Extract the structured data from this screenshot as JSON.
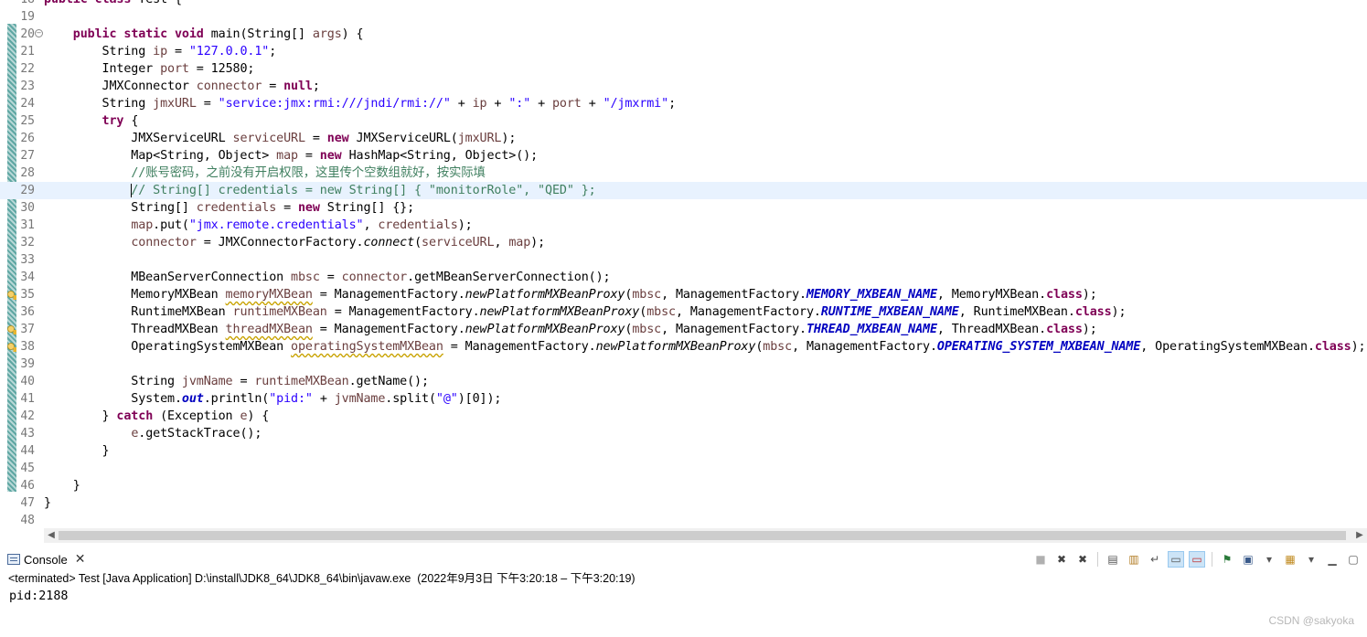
{
  "editor": {
    "lines": [
      {
        "n": "18",
        "html": "<span class=\"kw\">public class</span> Test {"
      },
      {
        "n": "19",
        "html": ""
      },
      {
        "n": "20",
        "fold": true,
        "html": "    <span class=\"kw\">public static void</span> main(String[] <span class=\"var\">args</span>) {"
      },
      {
        "n": "21",
        "html": "        String <span class=\"var\">ip</span> = <span class=\"str\">\"127.0.0.1\"</span>;"
      },
      {
        "n": "22",
        "html": "        Integer <span class=\"var\">port</span> = 12580;"
      },
      {
        "n": "23",
        "html": "        JMXConnector <span class=\"var\">connector</span> = <span class=\"kw\">null</span>;"
      },
      {
        "n": "24",
        "html": "        String <span class=\"var\">jmxURL</span> = <span class=\"str\">\"service:jmx:rmi:///jndi/rmi://\"</span> + <span class=\"var\">ip</span> + <span class=\"str\">\":\"</span> + <span class=\"var\">port</span> + <span class=\"str\">\"/jmxrmi\"</span>;"
      },
      {
        "n": "25",
        "html": "        <span class=\"kw\">try</span> {"
      },
      {
        "n": "26",
        "html": "            JMXServiceURL <span class=\"var\">serviceURL</span> = <span class=\"kw\">new</span> JMXServiceURL(<span class=\"var\">jmxURL</span>);"
      },
      {
        "n": "27",
        "html": "            Map&lt;String, Object&gt; <span class=\"var\">map</span> = <span class=\"kw\">new</span> HashMap&lt;String, Object&gt;();"
      },
      {
        "n": "28",
        "html": "            <span class=\"cmt\">//账号密码，之前没有开启权限，这里传个空数组就好，按实际填</span>"
      },
      {
        "n": "29",
        "current": true,
        "html": "            <span class=\"caret\"></span><span class=\"cmt\">// String[] credentials = new String[] { \"monitorRole\", \"QED\" };</span>"
      },
      {
        "n": "30",
        "html": "            String[] <span class=\"var\">credentials</span> = <span class=\"kw\">new</span> String[] {};"
      },
      {
        "n": "31",
        "html": "            <span class=\"var\">map</span>.put(<span class=\"str\">\"jmx.remote.credentials\"</span>, <span class=\"var\">credentials</span>);"
      },
      {
        "n": "32",
        "html": "            <span class=\"var\">connector</span> = JMXConnectorFactory.<span class=\"it\">connect</span>(<span class=\"var\">serviceURL</span>, <span class=\"var\">map</span>);"
      },
      {
        "n": "33",
        "html": ""
      },
      {
        "n": "34",
        "html": "            MBeanServerConnection <span class=\"var\">mbsc</span> = <span class=\"var\">connector</span>.getMBeanServerConnection();"
      },
      {
        "n": "35",
        "warn": true,
        "html": "            MemoryMXBean <span class=\"var warnsq\">memoryMXBean</span> = ManagementFactory.<span class=\"it\">newPlatformMXBeanProxy</span>(<span class=\"var\">mbsc</span>, ManagementFactory.<span class=\"sfld\">MEMORY_MXBEAN_NAME</span>, MemoryMXBean.<span class=\"kw\">class</span>);"
      },
      {
        "n": "36",
        "html": "            RuntimeMXBean <span class=\"var\">runtimeMXBean</span> = ManagementFactory.<span class=\"it\">newPlatformMXBeanProxy</span>(<span class=\"var\">mbsc</span>, ManagementFactory.<span class=\"sfld\">RUNTIME_MXBEAN_NAME</span>, RuntimeMXBean.<span class=\"kw\">class</span>);"
      },
      {
        "n": "37",
        "warn": true,
        "html": "            ThreadMXBean <span class=\"var warnsq\">threadMXBean</span> = ManagementFactory.<span class=\"it\">newPlatformMXBeanProxy</span>(<span class=\"var\">mbsc</span>, ManagementFactory.<span class=\"sfld\">THREAD_MXBEAN_NAME</span>, ThreadMXBean.<span class=\"kw\">class</span>);"
      },
      {
        "n": "38",
        "warn": true,
        "html": "            OperatingSystemMXBean <span class=\"var warnsq\">operatingSystemMXBean</span> = ManagementFactory.<span class=\"it\">newPlatformMXBeanProxy</span>(<span class=\"var\">mbsc</span>, ManagementFactory.<span class=\"sfld\">OPERATING_SYSTEM_MXBEAN_NAME</span>, OperatingSystemMXBean.<span class=\"kw\">class</span>);"
      },
      {
        "n": "39",
        "html": ""
      },
      {
        "n": "40",
        "html": "            String <span class=\"var\">jvmName</span> = <span class=\"var\">runtimeMXBean</span>.getName();"
      },
      {
        "n": "41",
        "html": "            System.<span class=\"sfld\">out</span>.println(<span class=\"str\">\"pid:\"</span> + <span class=\"var\">jvmName</span>.split(<span class=\"str\">\"@\"</span>)[0]);"
      },
      {
        "n": "42",
        "html": "        } <span class=\"kw\">catch</span> (Exception <span class=\"var\">e</span>) {"
      },
      {
        "n": "43",
        "html": "            <span class=\"var\">e</span>.getStackTrace();"
      },
      {
        "n": "44",
        "html": "        }"
      },
      {
        "n": "45",
        "html": ""
      },
      {
        "n": "46",
        "html": "    }"
      },
      {
        "n": "47",
        "html": "}"
      },
      {
        "n": "48",
        "html": ""
      }
    ]
  },
  "console": {
    "tab_label": "Console",
    "status": "<terminated> Test [Java Application] D:\\install\\JDK8_64\\JDK8_64\\bin\\javaw.exe  (2022年9月3日 下午3:20:18 – 下午3:20:19)",
    "output": "pid:2188",
    "toolbar_icons": [
      "terminate-icon",
      "remove-launch-icon",
      "remove-all-terminated-icon",
      "clear-console-icon",
      "scroll-lock-icon",
      "word-wrap-icon",
      "show-on-stdout-icon",
      "show-on-stderr-icon",
      "pin-console-icon",
      "display-console-icon",
      "display-console-dropdown-icon",
      "open-console-icon",
      "open-console-dropdown-icon",
      "minimize-icon",
      "maximize-icon"
    ]
  },
  "watermark": "CSDN @sakyoka",
  "colors": {
    "keyword": "#7f0055",
    "string": "#2a00ff",
    "local_var": "#6a3e3e",
    "static_field": "#0000c0",
    "comment": "#3f7f5f",
    "current_line": "#e8f2fe"
  }
}
